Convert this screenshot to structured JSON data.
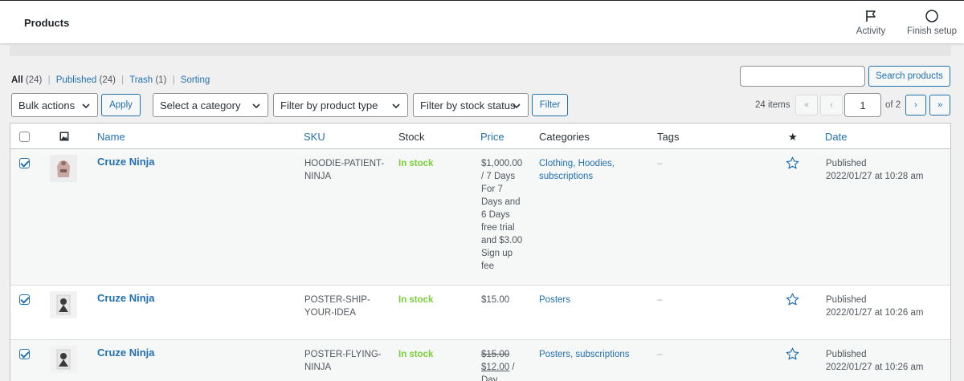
{
  "header": {
    "title": "Products",
    "activity_label": "Activity",
    "finish_setup_label": "Finish setup"
  },
  "views": {
    "all": "All",
    "all_count": "(24)",
    "published": "Published",
    "published_count": "(24)",
    "trash": "Trash",
    "trash_count": "(1)",
    "sorting": "Sorting",
    "sep": "|"
  },
  "search": {
    "value": "",
    "button": "Search products"
  },
  "tablenav": {
    "bulk_actions": "Bulk actions",
    "apply": "Apply",
    "category": "Select a category",
    "product_type": "Filter by product type",
    "stock_status": "Filter by stock status",
    "filter": "Filter",
    "items": "24 items",
    "first": "«",
    "prev": "‹",
    "page": "1",
    "of": "of 2",
    "next": "›",
    "last": "»"
  },
  "columns": {
    "name": "Name",
    "sku": "SKU",
    "stock": "Stock",
    "price": "Price",
    "categories": "Categories",
    "tags": "Tags",
    "featured": "★",
    "date": "Date"
  },
  "rows": [
    {
      "name": "Cruze Ninja",
      "sku": [
        "HOODIE-PATIENT-",
        "NINJA"
      ],
      "stock": "In stock",
      "price": [
        "$1,000.00",
        "/ 7 Days",
        "For 7",
        "Days and",
        "6 Days",
        "free trial",
        "and $3.00",
        "Sign up",
        "fee"
      ],
      "categories": [
        "Clothing, Hoodies,",
        "subscriptions"
      ],
      "tags": "–",
      "date_status": "Published",
      "date": "2022/01/27 at 10:28 am",
      "checked": true
    },
    {
      "name": "Cruze Ninja",
      "sku": [
        "POSTER-SHIP-",
        "YOUR-IDEA"
      ],
      "stock": "In stock",
      "price": [
        "$15.00"
      ],
      "categories": [
        "Posters"
      ],
      "tags": "–",
      "date_status": "Published",
      "date": "2022/01/27 at 10:26 am",
      "checked": true
    },
    {
      "name": "Cruze Ninja",
      "sku": [
        "POSTER-FLYING-",
        "NINJA"
      ],
      "stock": "In stock",
      "price_regular": "$15.00",
      "price_sale": "$12.00",
      "price_rest": "/",
      "price_more": "Day",
      "categories": [
        "Posters, subscriptions"
      ],
      "tags": "–",
      "date_status": "Published",
      "date": "2022/01/27 at 10:26 am",
      "checked": true
    }
  ],
  "colors": {
    "link": "#2271b1",
    "in_stock": "#7ad03a",
    "text": "#3c434a"
  }
}
